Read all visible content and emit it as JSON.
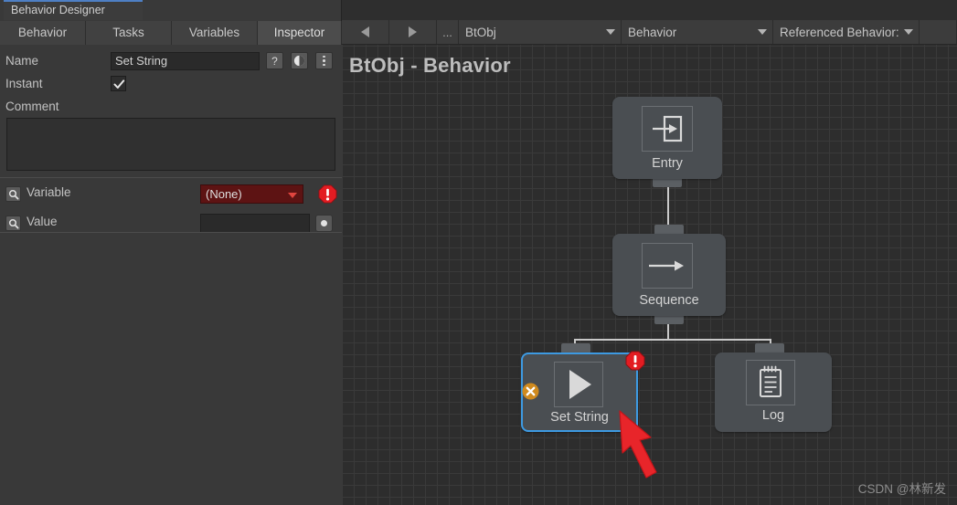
{
  "window": {
    "tab_label": "Behavior Designer"
  },
  "subtabs": [
    {
      "label": "Behavior",
      "active": false
    },
    {
      "label": "Tasks",
      "active": false
    },
    {
      "label": "Variables",
      "active": false
    },
    {
      "label": "Inspector",
      "active": true
    }
  ],
  "inspector": {
    "name_label": "Name",
    "name_value": "Set String",
    "help_button": "?",
    "preset_icon": "contrast-icon",
    "menu_icon": "three-dots-vertical-icon",
    "instant_label": "Instant",
    "instant_checked": true,
    "comment_label": "Comment",
    "comment_value": "",
    "variable_label": "Variable",
    "variable_value": "(None)",
    "variable_error_icon": "error-octagon-icon",
    "value_label": "Value",
    "value_value": "",
    "value_picker_icon": "object-picker-dot-icon",
    "search_icon": "magnifier-icon"
  },
  "toolbar": {
    "back_icon": "triangle-left-icon",
    "forward_icon": "triangle-right-icon",
    "more_label": "...",
    "object_dropdown": "BtObj",
    "behavior_dropdown": "Behavior",
    "referenced_behavior_dropdown": "Referenced Behavior:"
  },
  "graph": {
    "title": "BtObj - Behavior",
    "nodes": [
      {
        "label": "Entry",
        "icon": "enter-arrow-icon",
        "selected": false
      },
      {
        "label": "Sequence",
        "icon": "right-arrow-icon",
        "selected": false
      },
      {
        "label": "Set String",
        "icon": "play-triangle-icon",
        "selected": true,
        "error_badge": "error-octagon-icon",
        "disabled_badge": "x-circle-icon"
      },
      {
        "label": "Log",
        "icon": "notepad-icon",
        "selected": false
      }
    ]
  },
  "annotation": {
    "arrow_icon": "red-pointer-arrow-icon"
  },
  "watermark": {
    "text": "CSDN @林新发"
  },
  "colors": {
    "selection": "#3d9ae2",
    "error": "#e02020",
    "disabled_badge": "#d08a1e",
    "annotation": "#e8252a",
    "panel_bg": "#393939",
    "canvas_bg": "#2d2d2d",
    "node_bg": "#4a4e52",
    "variable_error_bg": "#5d1313"
  }
}
